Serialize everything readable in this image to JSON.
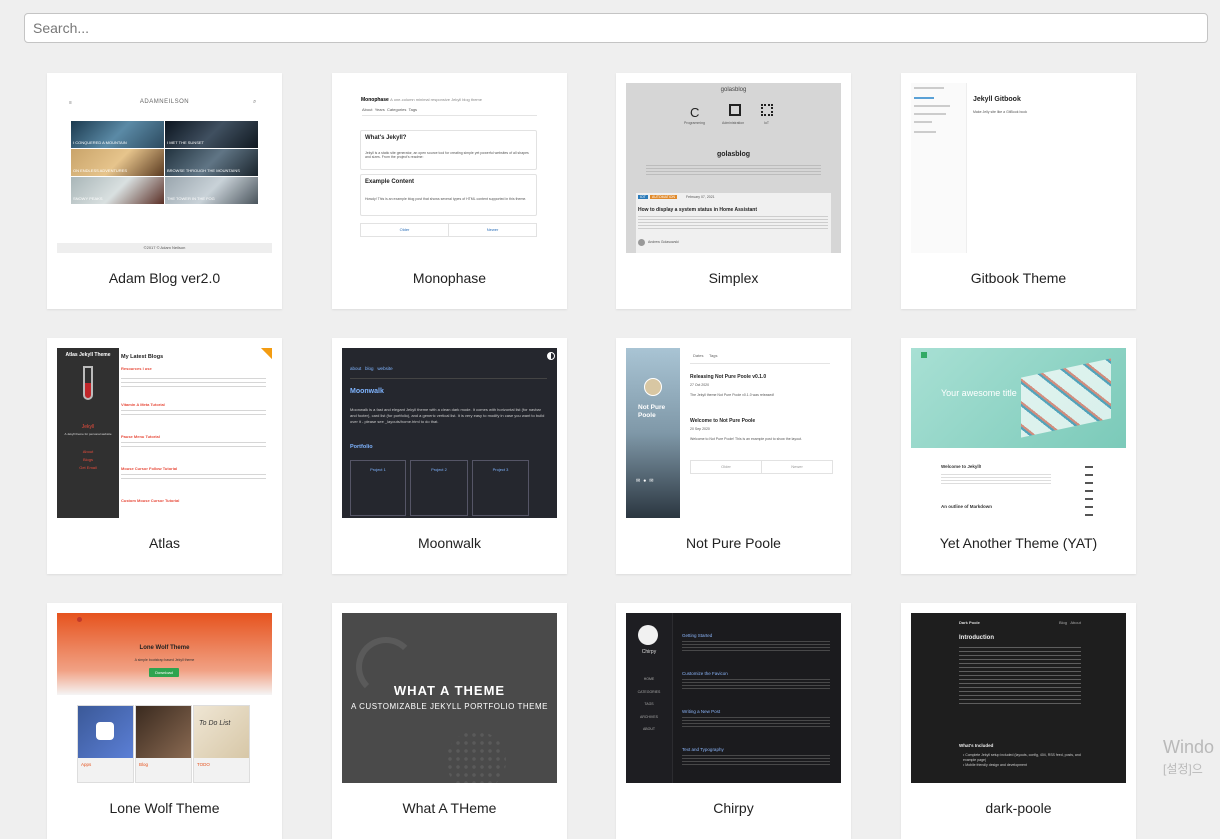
{
  "search": {
    "placeholder": "Search...",
    "value": ""
  },
  "themes": [
    {
      "name": "Adam Blog ver2.0",
      "preview": {
        "brand": "ADAMNEILSON",
        "posts": [
          "I CONQUERED A MOUNTAIN",
          "I MET THE SUNSET",
          "ON ENDLESS ADVENTURES",
          "BROWSE THROUGH THE MOUNTAINS",
          "SNOWY PEAKS",
          "THE TOWER IN THE FOG"
        ],
        "footer": "©2017 © Adam Neilson"
      }
    },
    {
      "name": "Monophase",
      "preview": {
        "title": "Monophase",
        "tagline": "A one-column minimal responsive Jekyll blog theme",
        "nav": [
          "About",
          "Years",
          "Categories",
          "Tags"
        ],
        "post1_title": "What's Jekyll?",
        "post1_body": "Jekyll is a static site generator, an open source tool for creating simple yet powerful websites of all shapes and sizes. From the project's readme:",
        "post2_title": "Example Content",
        "post2_body": "Howdy! This is an example blog post that shows several types of HTML content supported in this theme.",
        "older": "Older",
        "newer": "Newer"
      }
    },
    {
      "name": "Simplex",
      "preview": {
        "site": "golasblog",
        "icons": [
          "Programming",
          "Administration",
          "IoT"
        ],
        "heading": "golasblog",
        "tag1": "IOT",
        "tag2": "AUTOMATION",
        "date": "February 07, 2021",
        "post_title": "How to display a system status in Home Assistant",
        "author": "Andrew Golasowski"
      }
    },
    {
      "name": "Gitbook Theme",
      "preview": {
        "title": "Jekyll Gitbook",
        "body": "Make Jelly site like a GitBook book"
      }
    },
    {
      "name": "Atlas",
      "preview": {
        "side_title": "Atlas Jekyll Theme",
        "brand": "Jekyll",
        "side_sub": "A Jekyll theme for personal website",
        "side_links": [
          "About",
          "Blogs",
          "Get Email"
        ],
        "heading": "My Latest Blogs",
        "posts": [
          "Resources I use",
          "Vitamin A Meta Tutorial",
          "Pause Menu Tutorial",
          "Mouse Cursor Follow Tutorial",
          "Custom Mouse Cursor Tutorial"
        ]
      }
    },
    {
      "name": "Moonwalk",
      "preview": {
        "nav": [
          "about",
          "blog",
          "website"
        ],
        "title": "Moonwalk",
        "body": "Moonwalk is a fast and elegant Jekyll theme with a clean dark mode. It comes with horizontal list (for navbar and footer), card list (for portfolio), and a generic vertical list. It is very easy to modify in case you want to build over it - please see _layouts/home.html to do that.",
        "section": "Portfolio",
        "projects": [
          "Project 1",
          "Project 2",
          "Project 3"
        ]
      }
    },
    {
      "name": "Not Pure Poole",
      "preview": {
        "side_title": "Not Pure Poole",
        "tabs": [
          "Dates",
          "Tags"
        ],
        "post1_title": "Releasing Not Pure Poole v0.1.0",
        "post1_date": "27 Oct 2020",
        "post1_body": "The Jekyll theme Not Pure Poole v0.1.0 was released!",
        "post2_title": "Welcome to Not Pure Poole",
        "post2_date": "20 Sep 2020",
        "post2_body": "Welcome to Not Pure Poole! This is an example post to show the layout.",
        "older": "Older",
        "newer": "Newer"
      }
    },
    {
      "name": "Yet Another Theme (YAT)",
      "preview": {
        "banner": "Your awesome title",
        "post1": "Welcome to Jekyll!",
        "post2": "An outline of Markdown"
      }
    },
    {
      "name": "Lone Wolf Theme",
      "preview": {
        "title": "Lone Wolf Theme",
        "sub": "A simple bootstrap based Jekyll theme",
        "button": "Download",
        "tiles": [
          "Apps",
          "Blog",
          "TODO"
        ],
        "todo_card": "To Do List"
      }
    },
    {
      "name": "What A THeme",
      "preview": {
        "title": "WHAT A THEME",
        "sub": "A CUSTOMIZABLE JEKYLL PORTFOLIO THEME"
      }
    },
    {
      "name": "Chirpy",
      "preview": {
        "site": "Chirpy",
        "nav": [
          "HOME",
          "CATEGORIES",
          "TAGS",
          "ARCHIVES",
          "ABOUT"
        ],
        "posts": [
          "Getting Started",
          "Customize the Favicon",
          "Writing a New Post",
          "Text and Typography"
        ]
      }
    },
    {
      "name": "dark-poole",
      "preview": {
        "brand": "Dark Poole",
        "nav": [
          "Blog",
          "About"
        ],
        "title": "Introduction",
        "section": "What's Included",
        "bullets": [
          "Complete Jekyll setup included (layouts, config, 404, RSS feed, posts, and example page)",
          "Mobile friendly design and development"
        ]
      }
    }
  ],
  "watermark": {
    "line1": "Windo",
    "line2": "[설정]으"
  }
}
